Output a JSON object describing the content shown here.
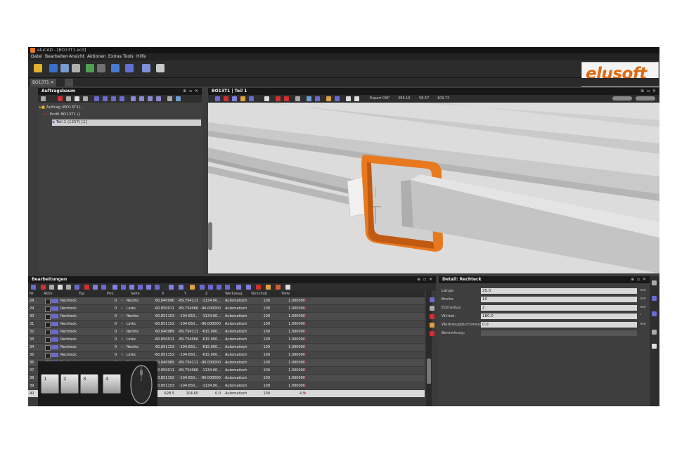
{
  "window_title": "eluCAD - [BO13T1.ecd]",
  "menu": [
    "Datei",
    "Bearbeiten",
    "Ansicht",
    "Aktionen",
    "Extras",
    "Tools",
    "Hilfe"
  ],
  "logo_text": "elusoft",
  "doc_tabs": [
    "BO13T1"
  ],
  "tree_panel": {
    "title": "Auftragsbaum",
    "nodes": [
      "Auftrag (BO13T1) -",
      "Profil BO13T1 ()",
      "Teil 1 (1257) [1]"
    ]
  },
  "viewport_panel": {
    "title": "BO13T1 | Teil 1",
    "mode": "Expert OXP",
    "coord_x": "399.16",
    "coord_y": "58.57",
    "coord_z": "-109.72"
  },
  "grid_panel": {
    "title": "Bearbeitungen",
    "headers": [
      "Nr.",
      "Aktiv",
      "Typ",
      "Prio.",
      "Seite",
      "X",
      "Y",
      "Z",
      "Werkzeug",
      "Vorschub",
      "Tiefe"
    ],
    "rows": [
      [
        "28",
        "Rechteck",
        "0",
        "Rechts",
        "60.840990",
        "-89.754111",
        "-1134.00...",
        "Automatisch",
        "100",
        "1.000000"
      ],
      [
        "29",
        "Rechteck",
        "0",
        "Links",
        "-60.850011",
        "-89.754066",
        "-96.000000",
        "Automatisch",
        "100",
        "1.000000"
      ],
      [
        "30",
        "Rechteck",
        "0",
        "Rechts",
        "60.851153",
        "-104.650...",
        "-1134.00...",
        "Automatisch",
        "100",
        "1.000000"
      ],
      [
        "31",
        "Rechteck",
        "0",
        "Links",
        "-60.851152",
        "-104.650...",
        "-96.000000",
        "Automatisch",
        "100",
        "1.000000"
      ],
      [
        "32",
        "Rechteck",
        "0",
        "Rechts",
        "60.840989",
        "-89.754111",
        "-615.000...",
        "Automatisch",
        "100",
        "1.000000"
      ],
      [
        "33",
        "Rechteck",
        "0",
        "Links",
        "-60.850011",
        "-89.754066",
        "-615.000...",
        "Automatisch",
        "100",
        "1.000000"
      ],
      [
        "34",
        "Rechteck",
        "0",
        "Rechts",
        "60.851153",
        "-104.650...",
        "-615.000...",
        "Automatisch",
        "100",
        "1.000000"
      ],
      [
        "35",
        "Rechteck",
        "0",
        "Links",
        "-60.851152",
        "-104.650...",
        "-615.000...",
        "Automatisch",
        "100",
        "1.000000"
      ],
      [
        "36",
        "Rechteck",
        "0",
        "Rechts",
        "60.840989",
        "-89.754111",
        "-96.000000",
        "Automatisch",
        "100",
        "1.000000"
      ],
      [
        "37",
        "Rechteck",
        "0",
        "Links",
        "-60.850011",
        "-89.754066",
        "-1134.00...",
        "Automatisch",
        "100",
        "1.000000"
      ],
      [
        "38",
        "Rechteck",
        "0",
        "Rechts",
        "60.851152",
        "-104.650...",
        "-96.000000",
        "Automatisch",
        "100",
        "1.000000"
      ],
      [
        "39",
        "Rechteck",
        "0",
        "Links",
        "-60.851153",
        "-104.650...",
        "-1134.00...",
        "Automatisch",
        "100",
        "1.000000"
      ],
      [
        "40",
        "Rechteck",
        "0",
        "Rechts",
        "628.5",
        "104.65",
        "0.0",
        "Automatisch",
        "100",
        "4.5"
      ]
    ]
  },
  "detail_panel": {
    "title": "Detail: Rechteck",
    "fields": [
      {
        "label": "Länge:",
        "value": "25.0",
        "unit": "mm"
      },
      {
        "label": "Breite:",
        "value": "10",
        "unit": "mm"
      },
      {
        "label": "Eckradius:",
        "value": "2",
        "unit": "mm"
      },
      {
        "label": "Winkel:",
        "value": "180.0",
        "unit": "°"
      },
      {
        "label": "Werkzeugdurchmesser:",
        "value": "0.0",
        "unit": "mm"
      },
      {
        "label": "Bemerkung:",
        "value": "",
        "unit": ""
      }
    ]
  },
  "keys": [
    "1",
    "2",
    "3",
    "4"
  ],
  "colors": {
    "accent": "#e8791f",
    "logo": "#e06a10",
    "delete": "#e03030"
  }
}
